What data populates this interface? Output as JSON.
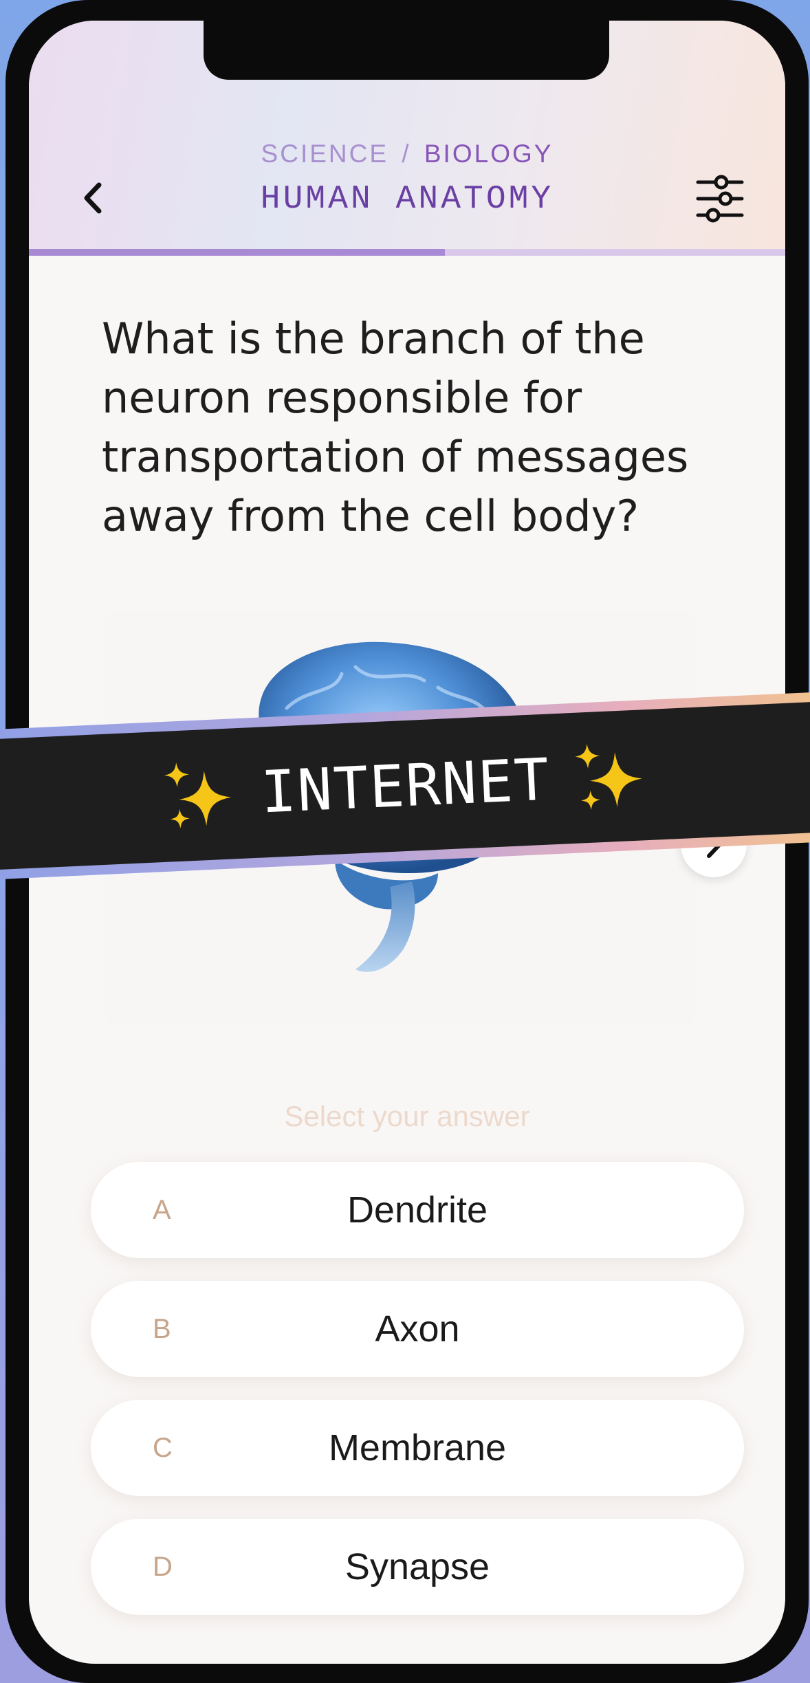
{
  "header": {
    "breadcrumb_parent": "SCIENCE",
    "breadcrumb_separator": "/",
    "breadcrumb_current": "BIOLOGY",
    "title": "HUMAN ANATOMY",
    "back_icon": "chevron-left-icon",
    "settings_icon": "sliders-icon",
    "progress_fraction": 0.55
  },
  "question": {
    "text": "What is the branch of the neuron responsible for transportation of messages away from the cell body?",
    "image_icon": "brain-image",
    "next_icon": "chevron-right-icon"
  },
  "banner": {
    "text": "INTERNET",
    "icon": "sparkles-icon"
  },
  "answers": {
    "prompt": "Select your answer",
    "options": [
      {
        "letter": "A",
        "text": "Dendrite"
      },
      {
        "letter": "B",
        "text": "Axon"
      },
      {
        "letter": "C",
        "text": "Membrane"
      },
      {
        "letter": "D",
        "text": "Synapse"
      }
    ]
  },
  "colors": {
    "accent": "#6a3fa3",
    "accent_light": "#a890cf",
    "letter": "#c7a58a",
    "banner_bg": "#1e1e1e",
    "sparkle": "#f5c518"
  }
}
